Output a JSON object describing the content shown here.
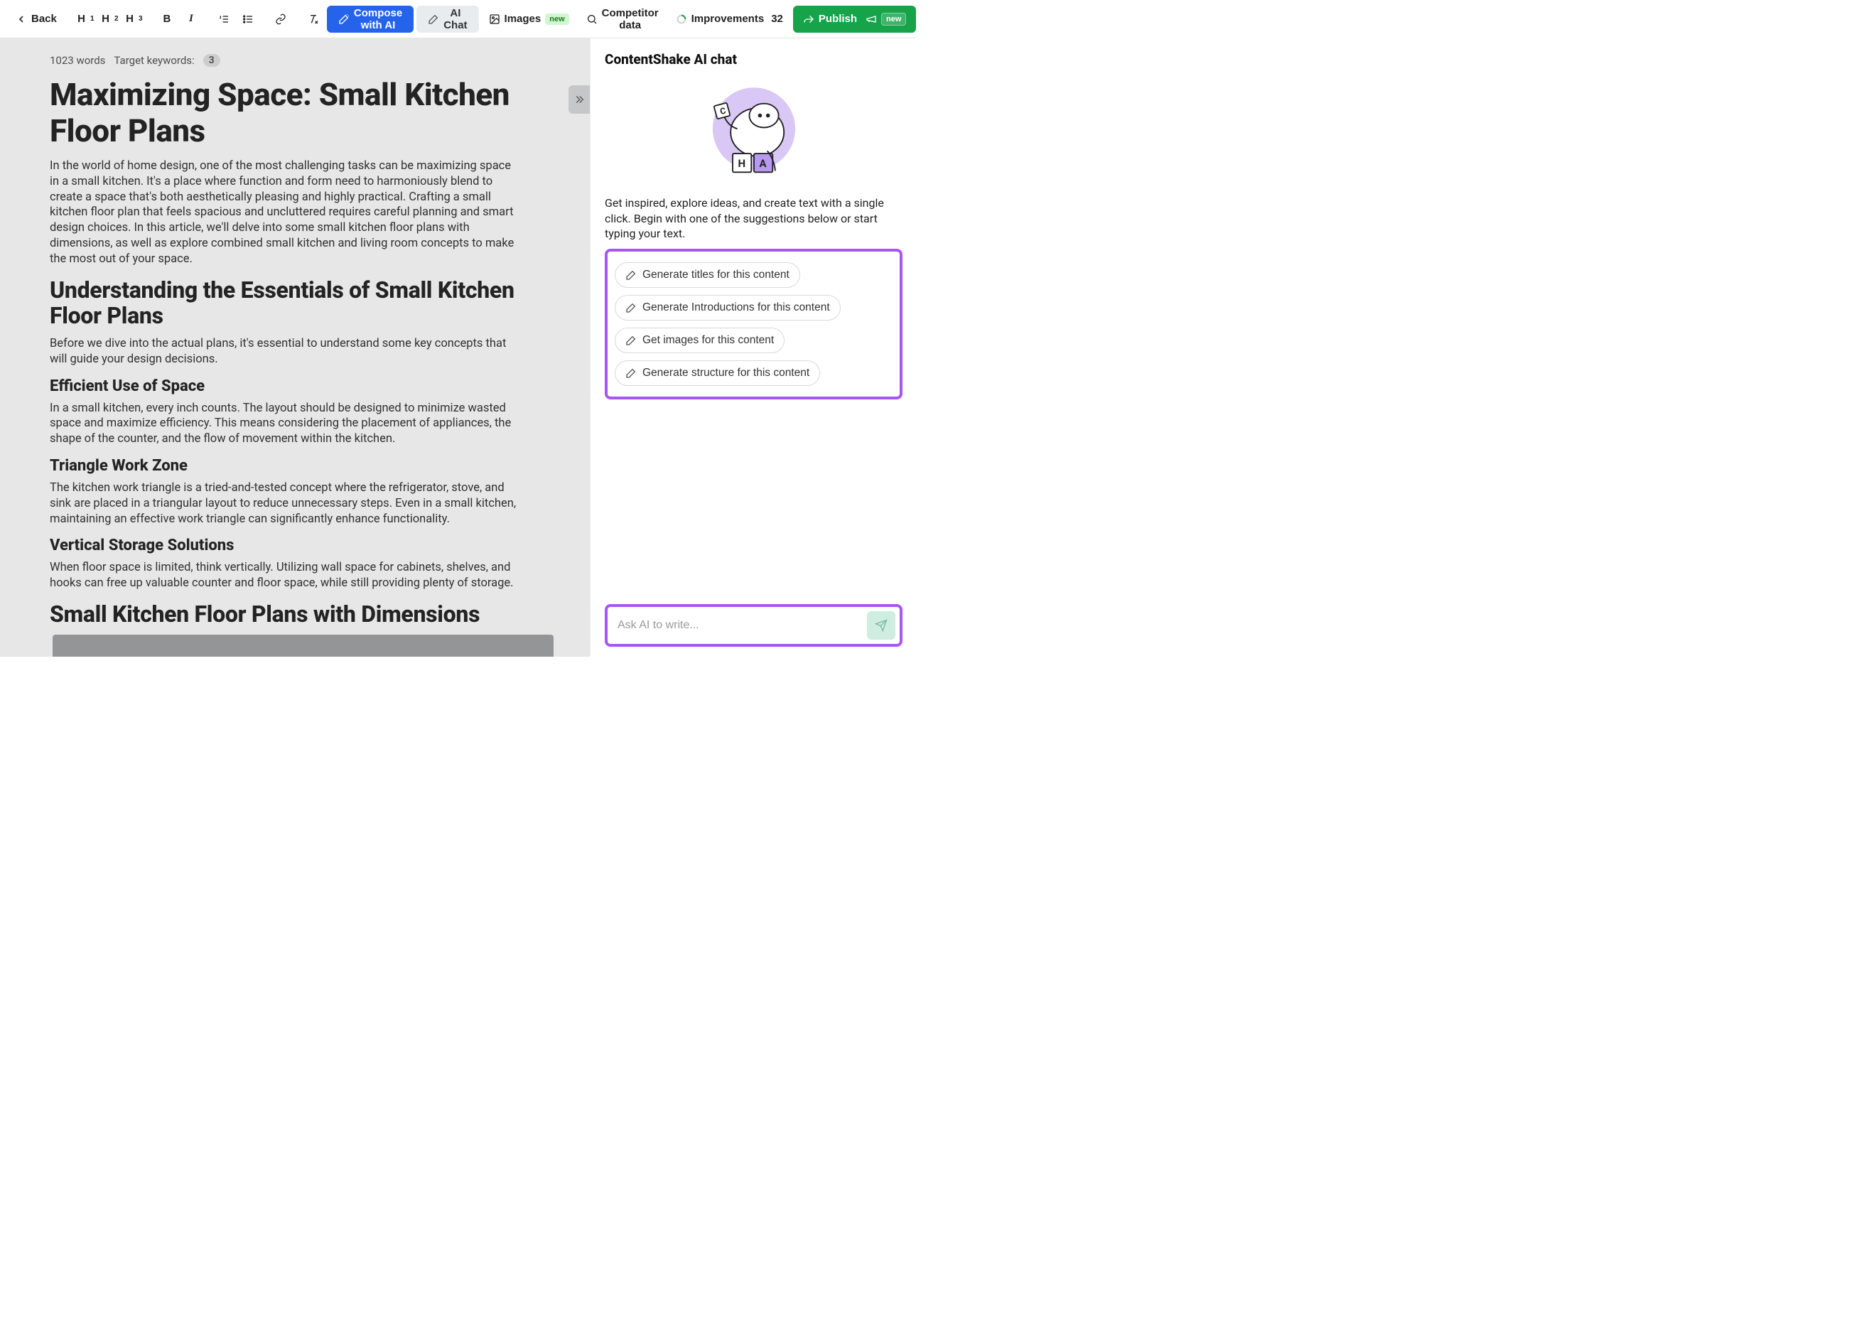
{
  "toolbar": {
    "back": "Back",
    "h1": "H",
    "h1sub": "1",
    "h2": "H",
    "h2sub": "2",
    "h3": "H",
    "h3sub": "3",
    "bold": "B",
    "italic": "I",
    "compose": "Compose with AI",
    "aichat": "AI Chat",
    "images": "Images",
    "images_badge": "new",
    "competitor": "Competitor data",
    "improvements": "Improvements",
    "improvements_count": "32",
    "publish": "Publish",
    "publish_badge": "new"
  },
  "meta": {
    "words": "1023 words",
    "target_label": "Target keywords:",
    "keyword_count": "3"
  },
  "article": {
    "title": "Maximizing Space: Small Kitchen Floor Plans",
    "p1": "In the world of home design, one of the most challenging tasks can be maximizing space in a small kitchen. It's a place where function and form need to harmoniously blend to create a space that's both aesthetically pleasing and highly practical. Crafting a small kitchen floor plan that feels spacious and uncluttered requires careful planning and smart design choices. In this article, we'll delve into some small kitchen floor plans with dimensions, as well as explore combined small kitchen and living room concepts to make the most out of your space.",
    "h2a": "Understanding the Essentials of Small Kitchen Floor Plans",
    "p2": "Before we dive into the actual plans, it's essential to understand some key concepts that will guide your design decisions.",
    "h3a": "Efficient Use of Space",
    "p3": "In a small kitchen, every inch counts. The layout should be designed to minimize wasted space and maximize efficiency. This means considering the placement of appliances, the shape of the counter, and the flow of movement within the kitchen.",
    "h3b": "Triangle Work Zone",
    "p4": "The kitchen work triangle is a tried-and-tested concept where the refrigerator, stove, and sink are placed in a triangular layout to reduce unnecessary steps. Even in a small kitchen, maintaining an effective work triangle can significantly enhance functionality.",
    "h3c": "Vertical Storage Solutions",
    "p5": "When floor space is limited, think vertically. Utilizing wall space for cabinets, shelves, and hooks can free up valuable counter and floor space, while still providing plenty of storage.",
    "h2b": "Small Kitchen Floor Plans with Dimensions"
  },
  "chat": {
    "title": "ContentShake AI chat",
    "intro": "Get inspired, explore ideas, and create text with a single click. Begin with one of the suggestions below or start typing your text.",
    "suggestions": [
      "Generate titles for this content",
      "Generate Introductions for this content",
      "Get images for this content",
      "Generate structure for this content"
    ],
    "placeholder": "Ask AI to write..."
  }
}
